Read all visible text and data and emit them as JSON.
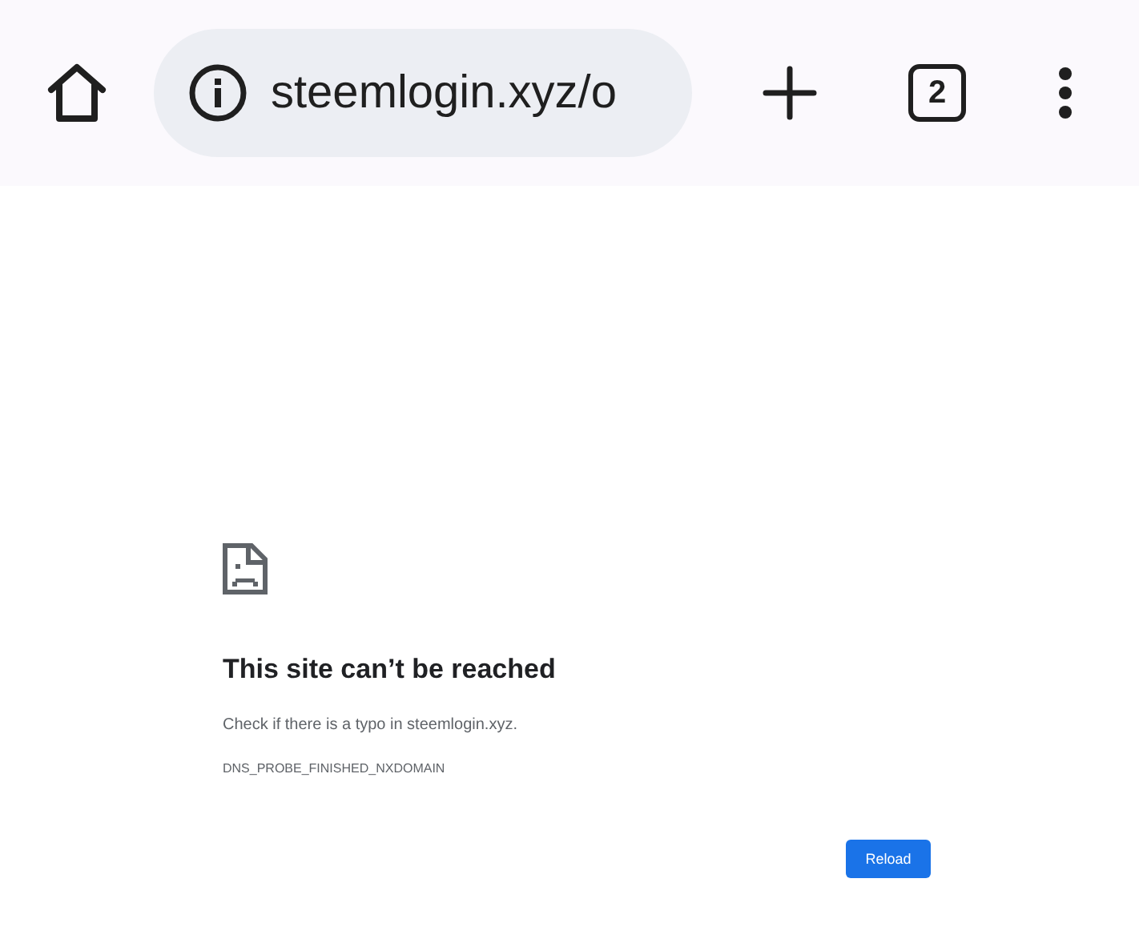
{
  "toolbar": {
    "url": "steemlogin.xyz/o",
    "tab_count": "2"
  },
  "error_page": {
    "title": "This site can’t be reached",
    "message": "Check if there is a typo in steemlogin.xyz.",
    "error_code": "DNS_PROBE_FINISHED_NXDOMAIN",
    "button": "Reload"
  }
}
